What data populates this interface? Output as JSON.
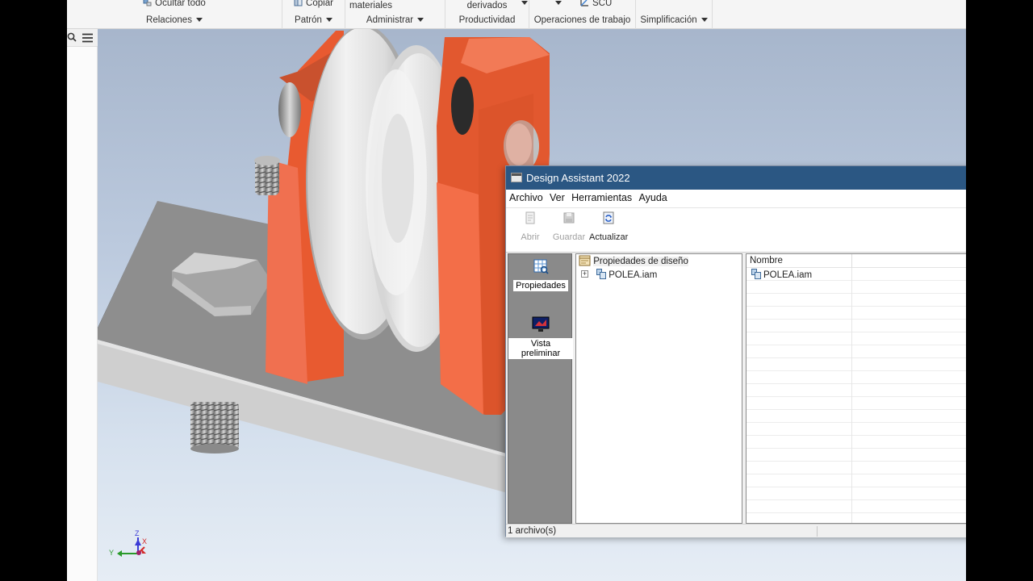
{
  "ribbon": {
    "groups": [
      {
        "top": "Ocultar todo",
        "label": "Relaciones"
      },
      {
        "top": "Copiar",
        "label": "Patrón"
      },
      {
        "top": "materiales",
        "label": "Administrar"
      },
      {
        "top": "derivados",
        "label": "Productividad"
      },
      {
        "top": "SCU",
        "label": "Operaciones de trabajo"
      },
      {
        "top": "",
        "label": "Simplificación"
      }
    ]
  },
  "browser": {
    "search_icon": "search-icon",
    "menu_icon": "hamburger-icon"
  },
  "viewcube": {
    "axis_z": "Z",
    "axis_y": "Y",
    "axis_x": "X"
  },
  "design_assistant": {
    "title": "Design Assistant 2022",
    "menu": [
      "Archivo",
      "Ver",
      "Herramientas",
      "Ayuda"
    ],
    "toolbar": {
      "open": "Abrir",
      "save": "Guardar",
      "refresh": "Actualizar"
    },
    "side": {
      "properties": "Propiedades",
      "preview": "Vista preliminar"
    },
    "tree": {
      "root": "Propiedades de diseño",
      "child": "POLEA.iam"
    },
    "list": {
      "column": "Nombre",
      "items": [
        "POLEA.iam"
      ]
    },
    "status": "1 archivo(s)"
  },
  "colors": {
    "title_bar": "#2b5783",
    "bracket": "#e8663f",
    "plate": "#8f8f8f"
  }
}
